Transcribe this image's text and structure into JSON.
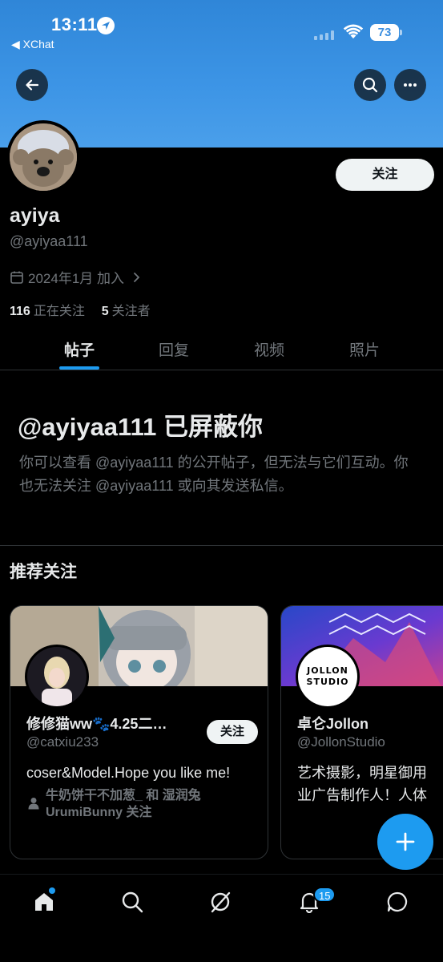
{
  "status_bar": {
    "time": "13:11",
    "back_app": "◀ XChat",
    "battery": "73"
  },
  "profile": {
    "display_name": "ayiya",
    "handle": "@ayiyaa111",
    "joined": "2024年1月 加入",
    "following_count": "116",
    "following_label": "正在关注",
    "followers_count": "5",
    "followers_label": "关注者",
    "follow_button": "关注"
  },
  "tabs": [
    {
      "label": "帖子",
      "active": true
    },
    {
      "label": "回复",
      "active": false
    },
    {
      "label": "视频",
      "active": false
    },
    {
      "label": "照片",
      "active": false
    }
  ],
  "blocked": {
    "title": "@ayiyaa111 已屏蔽你",
    "description": "你可以查看 @ayiyaa111 的公开帖子，但无法与它们互动。你也无法关注 @ayiyaa111 或向其发送私信。"
  },
  "recommendations": {
    "title": "推荐关注",
    "cards": [
      {
        "name": "修修猫ww🐾4.25二…",
        "handle": "@catxiu233",
        "bio": "coser&Model.Hope you like me!",
        "followed_by": "牛奶饼干不加葱_ 和 湿润兔 UrumiBunny 关注",
        "follow_button": "关注"
      },
      {
        "name": "卓仑Jollon",
        "handle": "@JollonStudio",
        "bio": "艺术摄影，明星御用 业广告制作人！人体",
        "avatar_text": "JOLLON STUDIO"
      }
    ]
  },
  "bottom_nav": {
    "items": [
      "home",
      "search",
      "grok",
      "notifications",
      "messages"
    ],
    "notification_count": "15"
  },
  "colors": {
    "accent": "#1d9bf0",
    "background": "#000000",
    "muted_text": "#71767b",
    "primary_text": "#e7e9ea"
  }
}
